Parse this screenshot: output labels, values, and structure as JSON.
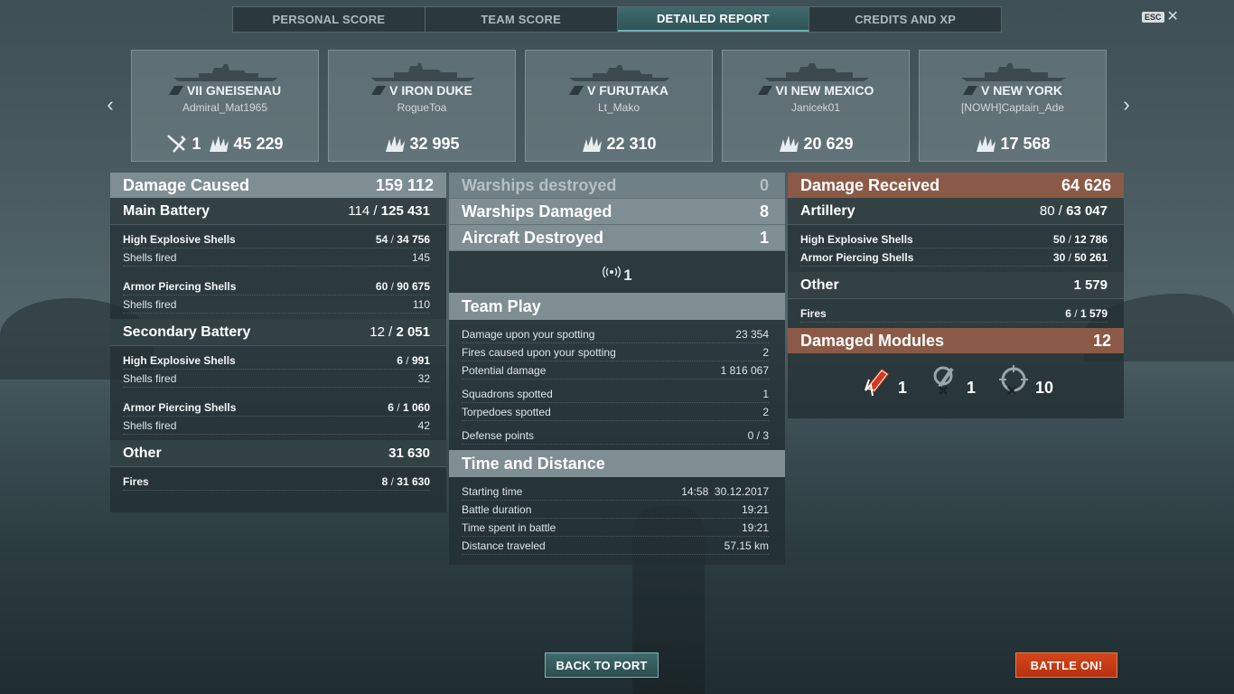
{
  "tabs": [
    {
      "label": "PERSONAL SCORE",
      "active": false
    },
    {
      "label": "TEAM SCORE",
      "active": false
    },
    {
      "label": "DETAILED REPORT",
      "active": true
    },
    {
      "label": "CREDITS AND XP",
      "active": false
    }
  ],
  "esc": {
    "key": "ESC",
    "close_glyph": "✕"
  },
  "nav": {
    "prev": "‹",
    "next": "›"
  },
  "cards": [
    {
      "ship": "VII GNEISENAU",
      "player": "Admiral_Mat1965",
      "kills": "1",
      "damage": "45 229"
    },
    {
      "ship": "V IRON DUKE",
      "player": "RogueToa",
      "damage": "32 995"
    },
    {
      "ship": "V FURUTAKA",
      "player": "Lt_Mako",
      "damage": "22 310"
    },
    {
      "ship": "VI NEW MEXICO",
      "player": "Janicek01",
      "damage": "20 629"
    },
    {
      "ship": "V NEW YORK",
      "player": "[NOWH]Captain_Ade",
      "damage": "17 568"
    }
  ],
  "damage_caused": {
    "title": "Damage Caused",
    "total": "159 112",
    "main_battery": {
      "label": "Main Battery",
      "hits": "114",
      "dmg": "125 431",
      "he": {
        "label": "High Explosive Shells",
        "hits": "54",
        "dmg": "34 756"
      },
      "he_fired": {
        "label": "Shells fired",
        "value": "145"
      },
      "ap": {
        "label": "Armor Piercing Shells",
        "hits": "60",
        "dmg": "90 675"
      },
      "ap_fired": {
        "label": "Shells fired",
        "value": "110"
      }
    },
    "secondary_battery": {
      "label": "Secondary Battery",
      "hits": "12",
      "dmg": "2 051",
      "he": {
        "label": "High Explosive Shells",
        "hits": "6",
        "dmg": "991"
      },
      "he_fired": {
        "label": "Shells fired",
        "value": "32"
      },
      "ap": {
        "label": "Armor Piercing Shells",
        "hits": "6",
        "dmg": "1 060"
      },
      "ap_fired": {
        "label": "Shells fired",
        "value": "42"
      }
    },
    "other": {
      "label": "Other",
      "total": "31 630",
      "fires": {
        "label": "Fires",
        "hits": "8",
        "dmg": "31 630"
      }
    }
  },
  "center": {
    "warships_destroyed": {
      "label": "Warships destroyed",
      "value": "0"
    },
    "warships_damaged": {
      "label": "Warships Damaged",
      "value": "8"
    },
    "aircraft_destroyed": {
      "label": "Aircraft Destroyed",
      "value": "1"
    },
    "spotting_count": "1",
    "team_play": {
      "title": "Team Play",
      "rows": [
        {
          "label": "Damage upon your spotting",
          "value": "23 354"
        },
        {
          "label": "Fires caused upon your spotting",
          "value": "2"
        },
        {
          "label": "Potential damage",
          "value": "1 816 067"
        },
        {
          "label": "Squadrons spotted",
          "value": "1"
        },
        {
          "label": "Torpedoes spotted",
          "value": "2"
        },
        {
          "label": "Defense points",
          "value": "0 / 3"
        }
      ]
    },
    "time_distance": {
      "title": "Time and Distance",
      "rows": [
        {
          "label": "Starting time",
          "value": "14:58  30.12.2017"
        },
        {
          "label": "Battle duration",
          "value": "19:21"
        },
        {
          "label": "Time spent in battle",
          "value": "19:21"
        },
        {
          "label": "Distance traveled",
          "value": "57.15 km"
        }
      ]
    }
  },
  "damage_received": {
    "title": "Damage Received",
    "total": "64 626",
    "artillery": {
      "label": "Artillery",
      "hits": "80",
      "dmg": "63 047",
      "he": {
        "label": "High Explosive Shells",
        "hits": "50",
        "dmg": "12 786"
      },
      "ap": {
        "label": "Armor Piercing Shells",
        "hits": "30",
        "dmg": "50 261"
      }
    },
    "other": {
      "label": "Other",
      "total": "1 579",
      "fires": {
        "label": "Fires",
        "hits": "6",
        "dmg": "1 579"
      }
    },
    "modules": {
      "title": "Damaged Modules",
      "total": "12",
      "items": [
        {
          "icon": "engine-damage-icon",
          "value": "1"
        },
        {
          "icon": "steering-damage-icon",
          "value": "1"
        },
        {
          "icon": "turret-damage-icon",
          "value": "10"
        }
      ]
    }
  },
  "buttons": {
    "back_to_port": "BACK TO PORT",
    "battle_on": "BATTLE ON!"
  },
  "colors": {
    "accent": "#3f6a6c",
    "battle": "#c83c16",
    "received": "#8b5a47",
    "header": "#7e8e93"
  }
}
